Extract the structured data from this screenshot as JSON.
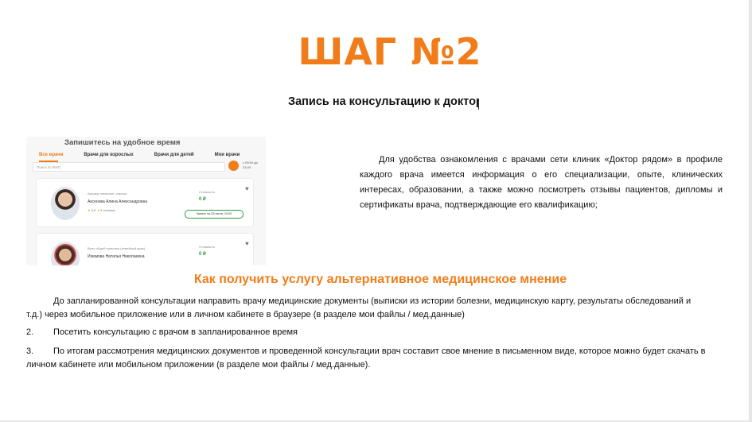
{
  "slide": {
    "title": "ШАГ №2",
    "subtitle": "Запись на консультацию к доктору"
  },
  "screenshot": {
    "heading": "Запишитесь на удобное время",
    "tabs": [
      "Все врачи",
      "Врачи для взрослых",
      "Врачи для детей",
      "Мои врачи"
    ],
    "search_placeholder": "Поиск по ФИО",
    "time_note": "с 09:00 до 21:00",
    "doctors": [
      {
        "specialty": "Акушер-гинеколог, онколог",
        "name": "Аксенова Алина Александровна",
        "rating": "4.8",
        "reviews": "5 отзывов",
        "price_label": "Стоимость",
        "price": "0 ₽",
        "book_label": "Запись на 25 июля, 10:00"
      },
      {
        "specialty": "Врач общей практики (семейный врач)",
        "name": "Изюмова Наталья Николаевна",
        "rating": "",
        "reviews": "",
        "price_label": "Стоимость",
        "price": "0 ₽",
        "book_label": ""
      }
    ]
  },
  "description": "Для удобства ознакомления с врачами сети клиник «Доктор рядом» в профиле каждого врача имеется информация о его специализации, опыте, клинических интересах, образовании, а также можно посмотреть отзывы пациентов, дипломы и сертификаты врача, подтверждающие его квалификацию;",
  "section": {
    "heading": "Как получить услугу альтернативное медицинское мнение",
    "items": [
      {
        "number": "",
        "text": "До запланированной консультации направить врачу медицинские документы (выписки из истории болезни, медицинскую карту, результаты обследований и т.д.) через мобильное приложение или в личном кабинете в браузере (в разделе мои файлы / мед.данные)"
      },
      {
        "number": "2.",
        "text": "Посетить консультацию с врачом в запланированное время"
      },
      {
        "number": "3.",
        "text": "По итогам рассмотрения медицинских документов и проведенной консультации врач составит свое мнение в письменном виде, которое можно будет скачать в личном кабинете или мобильном приложении (в разделе мои файлы / мед.данные)."
      }
    ]
  },
  "colors": {
    "accent": "#f07d1a",
    "price_green": "#2a9d4a"
  }
}
